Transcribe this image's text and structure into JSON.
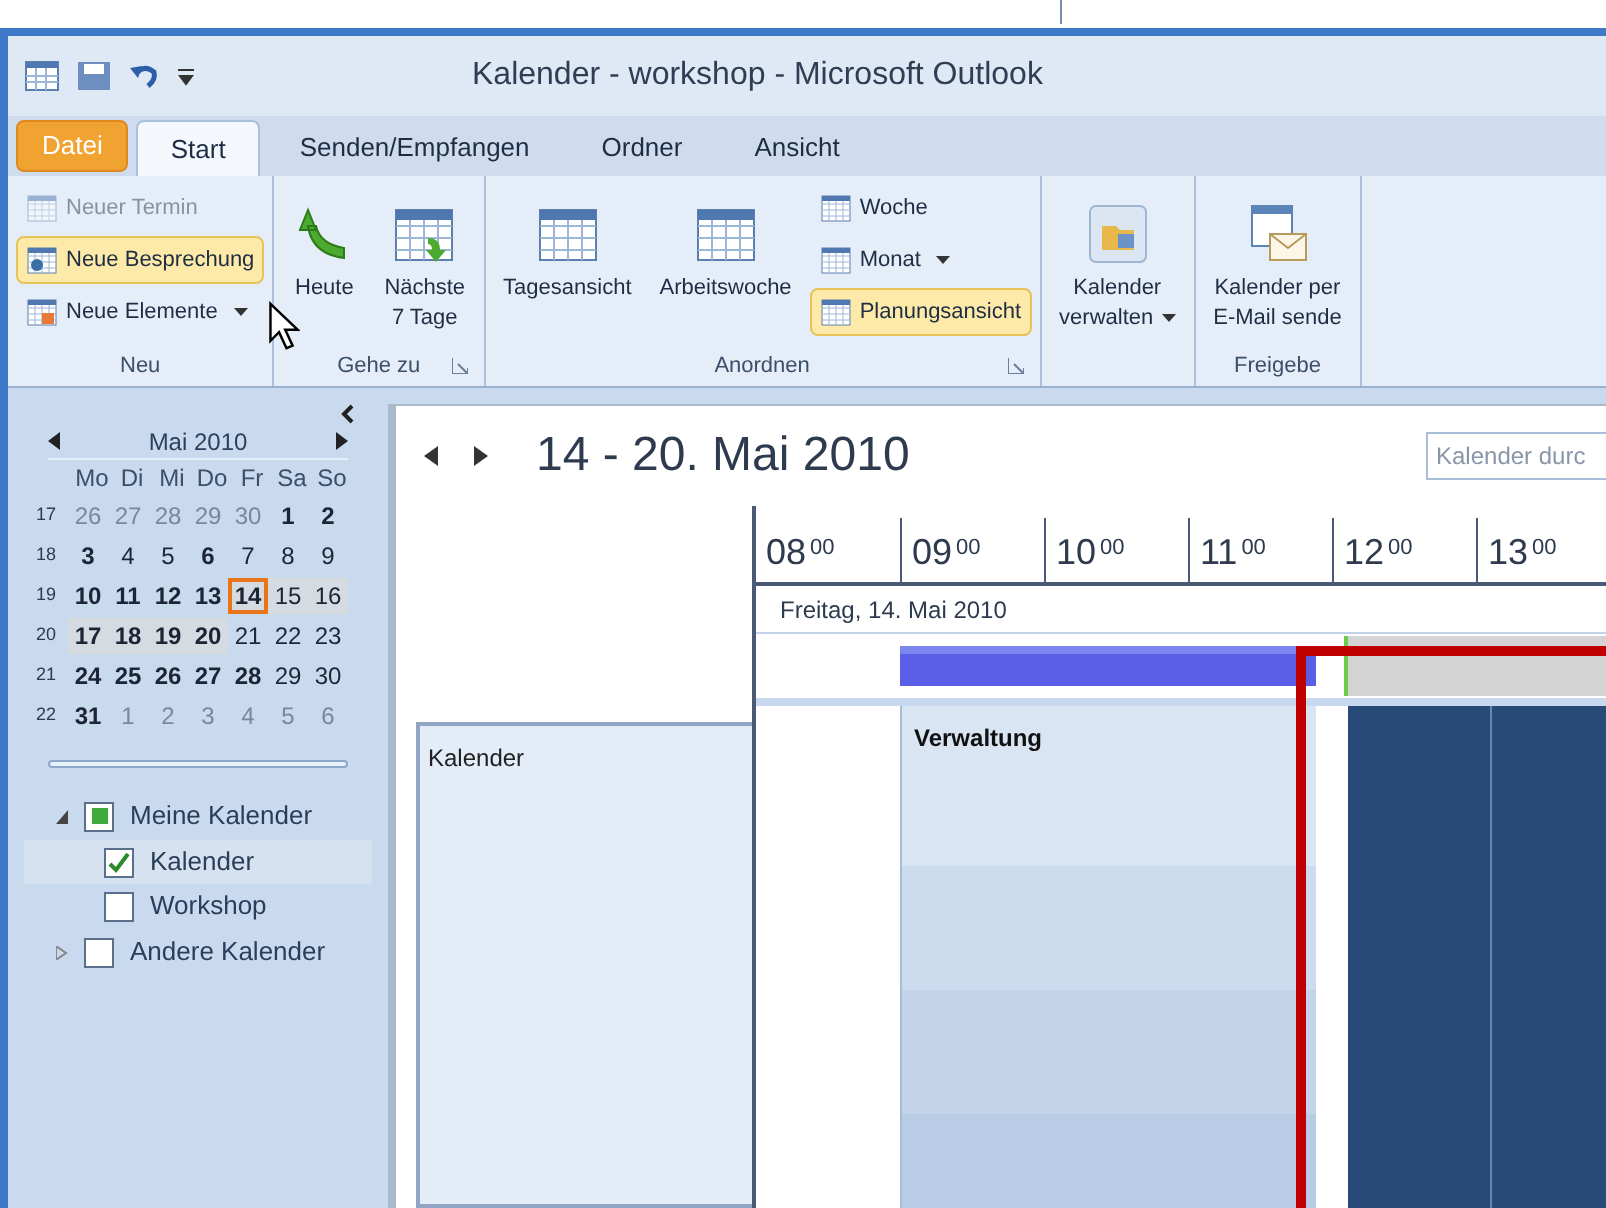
{
  "window": {
    "title": "Kalender - workshop - Microsoft Outlook"
  },
  "tabs": [
    {
      "label": "Datei",
      "kind": "file",
      "selected": false
    },
    {
      "label": "Start",
      "kind": "tab",
      "selected": true
    },
    {
      "label": "Senden/Empfangen",
      "kind": "tab",
      "selected": false
    },
    {
      "label": "Ordner",
      "kind": "tab",
      "selected": false
    },
    {
      "label": "Ansicht",
      "kind": "tab",
      "selected": false
    }
  ],
  "ribbon": [
    {
      "label": "Neu",
      "launcher": false,
      "items": [
        {
          "kind": "small",
          "lines": [
            "Neuer Termin"
          ],
          "disabled": true,
          "selected": false,
          "dropdown": false
        },
        {
          "kind": "small",
          "lines": [
            "Neue Besprechung"
          ],
          "disabled": false,
          "selected": true,
          "dropdown": false
        },
        {
          "kind": "small",
          "lines": [
            "Neue Elemente"
          ],
          "disabled": false,
          "selected": false,
          "dropdown": true
        }
      ]
    },
    {
      "label": "Gehe zu",
      "launcher": true,
      "items": [
        {
          "kind": "large",
          "lines": [
            "Heute"
          ],
          "disabled": false,
          "selected": false,
          "dropdown": false
        },
        {
          "kind": "large",
          "lines": [
            "Nächste",
            "7 Tage"
          ],
          "disabled": false,
          "selected": false,
          "dropdown": false
        }
      ]
    },
    {
      "label": "Anordnen",
      "launcher": true,
      "items": [
        {
          "kind": "large",
          "lines": [
            "Tagesansicht"
          ],
          "disabled": false,
          "selected": false,
          "dropdown": false
        },
        {
          "kind": "large",
          "lines": [
            "Arbeitswoche"
          ],
          "disabled": false,
          "selected": false,
          "dropdown": false
        },
        {
          "kind": "small",
          "lines": [
            "Woche"
          ],
          "disabled": false,
          "selected": false,
          "dropdown": false
        },
        {
          "kind": "small",
          "lines": [
            "Monat"
          ],
          "disabled": false,
          "selected": false,
          "dropdown": true
        },
        {
          "kind": "small",
          "lines": [
            "Planungsansicht"
          ],
          "disabled": false,
          "selected": true,
          "dropdown": false
        }
      ]
    },
    {
      "launcher": false,
      "items": [
        {
          "kind": "large",
          "lines": [
            "Kalender",
            "verwalten"
          ],
          "disabled": false,
          "selected": false,
          "dropdown": true
        }
      ]
    },
    {
      "label": "Freigebe",
      "launcher": false,
      "items": [
        {
          "kind": "large",
          "lines": [
            "Kalender per",
            "E-Mail sende"
          ],
          "disabled": false,
          "selected": false,
          "dropdown": false
        }
      ]
    }
  ],
  "mini_calendar": {
    "month": "Mai 2010",
    "weekdays": [
      "Mo",
      "Di",
      "Mi",
      "Do",
      "Fr",
      "Sa",
      "So"
    ],
    "weeks": [
      {
        "number": "17",
        "days": [
          {
            "day": "26",
            "other_month": true,
            "bold": false,
            "selected": false,
            "today": false
          },
          {
            "day": "27",
            "other_month": true,
            "bold": false,
            "selected": false,
            "today": false
          },
          {
            "day": "28",
            "other_month": true,
            "bold": false,
            "selected": false,
            "today": false
          },
          {
            "day": "29",
            "other_month": true,
            "bold": false,
            "selected": false,
            "today": false
          },
          {
            "day": "30",
            "other_month": true,
            "bold": false,
            "selected": false,
            "today": false
          },
          {
            "day": "1",
            "other_month": false,
            "bold": true,
            "selected": false,
            "today": false
          },
          {
            "day": "2",
            "other_month": false,
            "bold": true,
            "selected": false,
            "today": false
          }
        ]
      },
      {
        "number": "18",
        "days": [
          {
            "day": "3",
            "other_month": false,
            "bold": true,
            "selected": false,
            "today": false
          },
          {
            "day": "4",
            "other_month": false,
            "bold": false,
            "selected": false,
            "today": false
          },
          {
            "day": "5",
            "other_month": false,
            "bold": false,
            "selected": false,
            "today": false
          },
          {
            "day": "6",
            "other_month": false,
            "bold": true,
            "selected": false,
            "today": false
          },
          {
            "day": "7",
            "other_month": false,
            "bold": false,
            "selected": false,
            "today": false
          },
          {
            "day": "8",
            "other_month": false,
            "bold": false,
            "selected": false,
            "today": false
          },
          {
            "day": "9",
            "other_month": false,
            "bold": false,
            "selected": false,
            "today": false
          }
        ]
      },
      {
        "number": "19",
        "days": [
          {
            "day": "10",
            "other_month": false,
            "bold": true,
            "selected": false,
            "today": false
          },
          {
            "day": "11",
            "other_month": false,
            "bold": true,
            "selected": false,
            "today": false
          },
          {
            "day": "12",
            "other_month": false,
            "bold": true,
            "selected": false,
            "today": false
          },
          {
            "day": "13",
            "other_month": false,
            "bold": true,
            "selected": false,
            "today": false
          },
          {
            "day": "14",
            "other_month": false,
            "bold": true,
            "selected": true,
            "today": true
          },
          {
            "day": "15",
            "other_month": false,
            "bold": false,
            "selected": true,
            "today": false
          },
          {
            "day": "16",
            "other_month": false,
            "bold": false,
            "selected": true,
            "today": false
          }
        ]
      },
      {
        "number": "20",
        "days": [
          {
            "day": "17",
            "other_month": false,
            "bold": true,
            "selected": true,
            "today": false
          },
          {
            "day": "18",
            "other_month": false,
            "bold": true,
            "selected": true,
            "today": false
          },
          {
            "day": "19",
            "other_month": false,
            "bold": true,
            "selected": true,
            "today": false
          },
          {
            "day": "20",
            "other_month": false,
            "bold": true,
            "selected": true,
            "today": false
          },
          {
            "day": "21",
            "other_month": false,
            "bold": false,
            "selected": false,
            "today": false
          },
          {
            "day": "22",
            "other_month": false,
            "bold": false,
            "selected": false,
            "today": false
          },
          {
            "day": "23",
            "other_month": false,
            "bold": false,
            "selected": false,
            "today": false
          }
        ]
      },
      {
        "number": "21",
        "days": [
          {
            "day": "24",
            "other_month": false,
            "bold": true,
            "selected": false,
            "today": false
          },
          {
            "day": "25",
            "other_month": false,
            "bold": true,
            "selected": false,
            "today": false
          },
          {
            "day": "26",
            "other_month": false,
            "bold": true,
            "selected": false,
            "today": false
          },
          {
            "day": "27",
            "other_month": false,
            "bold": true,
            "selected": false,
            "today": false
          },
          {
            "day": "28",
            "other_month": false,
            "bold": true,
            "selected": false,
            "today": false
          },
          {
            "day": "29",
            "other_month": false,
            "bold": false,
            "selected": false,
            "today": false
          },
          {
            "day": "30",
            "other_month": false,
            "bold": false,
            "selected": false,
            "today": false
          }
        ]
      },
      {
        "number": "22",
        "days": [
          {
            "day": "31",
            "other_month": false,
            "bold": true,
            "selected": false,
            "today": false
          },
          {
            "day": "1",
            "other_month": true,
            "bold": false,
            "selected": false,
            "today": false
          },
          {
            "day": "2",
            "other_month": true,
            "bold": false,
            "selected": false,
            "today": false
          },
          {
            "day": "3",
            "other_month": true,
            "bold": false,
            "selected": false,
            "today": false
          },
          {
            "day": "4",
            "other_month": true,
            "bold": false,
            "selected": false,
            "today": false
          },
          {
            "day": "5",
            "other_month": true,
            "bold": false,
            "selected": false,
            "today": false
          },
          {
            "day": "6",
            "other_month": true,
            "bold": false,
            "selected": false,
            "today": false
          }
        ]
      }
    ]
  },
  "calendar_tree": [
    {
      "label": "Meine Kalender",
      "expanded": true,
      "checked": false,
      "partial": true,
      "selected": false,
      "children": [
        {
          "label": "Kalender",
          "checked": true,
          "selected": true
        },
        {
          "label": "Workshop",
          "checked": false,
          "selected": false
        }
      ]
    },
    {
      "label": "Andere Kalender",
      "expanded": false,
      "checked": false,
      "partial": false,
      "selected": false
    }
  ],
  "schedule": {
    "range": "14 - 20. Mai 2010",
    "search": {
      "placeholder": "Kalender durc"
    },
    "hours": [
      {
        "hour": "08",
        "minutes": "00"
      },
      {
        "hour": "09",
        "minutes": "00"
      },
      {
        "hour": "10",
        "minutes": "00"
      },
      {
        "hour": "11",
        "minutes": "00"
      },
      {
        "hour": "12",
        "minutes": "00"
      },
      {
        "hour": "13",
        "minutes": "00"
      }
    ],
    "day": "Freitag, 14. Mai 2010",
    "resource": "Kalender",
    "event": {
      "title": "Verwaltung"
    }
  }
}
